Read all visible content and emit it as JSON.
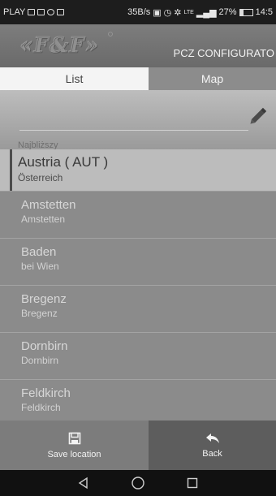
{
  "status_bar": {
    "carrier": "PLAY",
    "speed": "35B/s",
    "network": "LTE",
    "battery": "27%",
    "battery_level": 0.27,
    "time": "14:5"
  },
  "header": {
    "logo_text": "«F&F»",
    "title": "PCZ CONFIGURATO"
  },
  "tabs": [
    {
      "label": "List",
      "active": true
    },
    {
      "label": "Map",
      "active": false
    }
  ],
  "search": {
    "value": "",
    "placeholder": "",
    "cut_label": "Najbliższy"
  },
  "country": {
    "name": "Austria ( AUT )",
    "native": "Österreich"
  },
  "locations": [
    {
      "name": "Amstetten",
      "sub": "Amstetten"
    },
    {
      "name": "Baden",
      "sub": "bei Wien"
    },
    {
      "name": "Bregenz",
      "sub": "Bregenz"
    },
    {
      "name": "Dornbirn",
      "sub": "Dornbirn"
    },
    {
      "name": "Feldkirch",
      "sub": "Feldkirch"
    }
  ],
  "actions": {
    "save_label": "Save location",
    "back_label": "Back"
  },
  "icons": {
    "pencil": "pencil-icon",
    "save": "floppy-disk-icon",
    "back": "reply-arrow-icon",
    "nav_back": "triangle-back-icon",
    "nav_home": "circle-home-icon",
    "nav_recent": "square-recent-icon"
  }
}
